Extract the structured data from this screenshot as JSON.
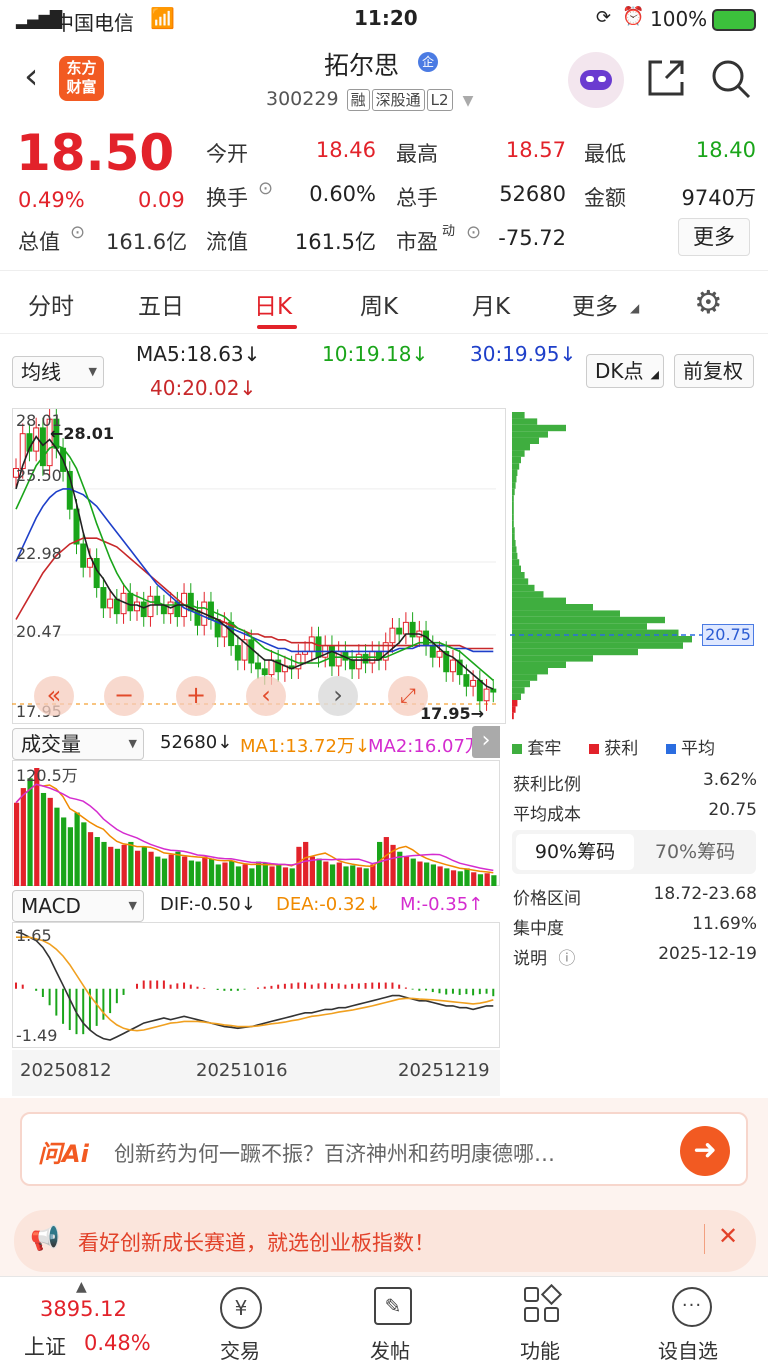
{
  "status_bar": {
    "carrier": "中国电信",
    "time": "11:20",
    "battery": "100%"
  },
  "header": {
    "logo_line1": "东方",
    "logo_line2": "财富",
    "stock_name": "拓尔思",
    "badge": "企",
    "code": "300229",
    "tags": [
      "融",
      "深股通",
      "L2"
    ]
  },
  "quote": {
    "price": "18.50",
    "change_pct": "0.49%",
    "change": "0.09",
    "open_label": "今开",
    "open": "18.46",
    "high_label": "最高",
    "high": "18.57",
    "low_label": "最低",
    "low": "18.40",
    "turnover_label": "换手",
    "turnover": "0.60%",
    "volume_label": "总手",
    "volume": "52680",
    "amount_label": "金额",
    "amount": "9740万",
    "mcap_label": "总值",
    "mcap": "161.6亿",
    "float_label": "流值",
    "float": "161.5亿",
    "pe_label": "市盈",
    "pe_sup": "动",
    "pe": "-75.72",
    "more": "更多"
  },
  "tabs": [
    "分时",
    "五日",
    "日K",
    "周K",
    "月K",
    "更多"
  ],
  "active_tab": "日K",
  "ma_bar": {
    "select": "均线",
    "ma5": "MA5:18.63↓",
    "ma10": "10:19.18↓",
    "ma30": "30:19.95↓",
    "ma40": "40:20.02↓",
    "dk": "DK点",
    "adj": "前复权"
  },
  "kline": {
    "y_labels": [
      "28.01",
      "25.50",
      "22.98",
      "20.47",
      "17.95"
    ],
    "max_mark": "28.01",
    "min_mark": "17.95"
  },
  "volume_bar": {
    "select": "成交量",
    "vol": "52680↓",
    "ma1": "MA1:13.72万↓",
    "ma2": "MA2:16.07万↓",
    "top_label": "120.5万"
  },
  "macd_bar": {
    "select": "MACD",
    "dif": "DIF:-0.50↓",
    "dea": "DEA:-0.32↓",
    "m": "M:-0.35↑",
    "top_label": "1.65",
    "bottom_label": "-1.49"
  },
  "dates": [
    "20250812",
    "20251016",
    "20251219"
  ],
  "chips": {
    "price_tag": "20.75",
    "legend": [
      "套牢",
      "获利",
      "平均"
    ],
    "profit_ratio_label": "获利比例",
    "profit_ratio": "3.62%",
    "avg_cost_label": "平均成本",
    "avg_cost": "20.75",
    "tab90": "90%筹码",
    "tab70": "70%筹码",
    "range_label": "价格区间",
    "range": "18.72-23.68",
    "conc_label": "集中度",
    "conc": "11.69%",
    "note_label": "说明",
    "note_date": "2025-12-19"
  },
  "ask": {
    "logo": "问Ai",
    "text": "创新药为何一蹶不振？百济神州和药明康德哪…"
  },
  "banner": {
    "text": "看好创新成长赛道，就选创业板指数！"
  },
  "tabbar": {
    "index_value": "3895.12",
    "index_name": "上证",
    "index_pct": "0.48%",
    "items": [
      "交易",
      "发帖",
      "功能",
      "设自选"
    ]
  },
  "colors": {
    "up": "#e2222a",
    "down": "#1aa51a",
    "accent": "#f25a22",
    "ma30": "#1e3fc9",
    "ma40": "#c8282a"
  },
  "chart_data": {
    "type": "candlestick",
    "close_series": [
      26.2,
      27.4,
      26.8,
      27.6,
      26.3,
      27.9,
      26.9,
      26.1,
      24.8,
      23.6,
      22.8,
      23.1,
      22.1,
      21.4,
      21.7,
      21.2,
      21.9,
      21.3,
      21.6,
      21.1,
      21.8,
      21.5,
      21.2,
      21.6,
      21.1,
      21.9,
      21.3,
      20.8,
      21.6,
      21.0,
      20.4,
      20.9,
      20.1,
      19.6,
      20.3,
      19.5,
      19.3,
      19.1,
      19.6,
      19.2,
      19.4,
      19.3,
      19.8,
      19.9,
      20.4,
      19.7,
      20.1,
      19.4,
      19.9,
      19.6,
      19.3,
      19.8,
      19.5,
      19.9,
      19.6,
      20.2,
      20.7,
      20.5,
      20.9,
      20.4,
      20.6,
      20.1,
      19.7,
      19.9,
      19.2,
      19.6,
      19.1,
      18.7,
      18.9,
      18.2,
      18.6,
      18.5
    ],
    "ma5_series": [
      25.5,
      26.3,
      26.9,
      27.3,
      27.0,
      27.2,
      26.9,
      26.5,
      25.9,
      25.0,
      24.0,
      23.2,
      22.7,
      22.4,
      22.0,
      21.7,
      21.6,
      21.5,
      21.5,
      21.4,
      21.5,
      21.5,
      21.5,
      21.4,
      21.5,
      21.5,
      21.4,
      21.3,
      21.2,
      21.1,
      21.0,
      20.8,
      20.6,
      20.4,
      20.2,
      20.0,
      19.8,
      19.6,
      19.6,
      19.5,
      19.4,
      19.3,
      19.4,
      19.5,
      19.6,
      19.7,
      19.8,
      19.9,
      19.8,
      19.7,
      19.6,
      19.6,
      19.6,
      19.6,
      19.6,
      19.8,
      20.0,
      20.2,
      20.5,
      20.5,
      20.5,
      20.4,
      20.2,
      20.0,
      19.8,
      19.7,
      19.5,
      19.3,
      19.1,
      18.9,
      18.7,
      18.6
    ],
    "ma10_series": [
      24.8,
      25.3,
      25.8,
      26.3,
      26.6,
      26.9,
      27.0,
      26.9,
      26.6,
      26.2,
      25.6,
      25.0,
      24.3,
      23.7,
      23.1,
      22.6,
      22.2,
      21.9,
      21.8,
      21.7,
      21.6,
      21.6,
      21.5,
      21.5,
      21.5,
      21.5,
      21.5,
      21.4,
      21.4,
      21.3,
      21.2,
      21.1,
      20.9,
      20.7,
      20.6,
      20.4,
      20.2,
      20.0,
      19.9,
      19.8,
      19.7,
      19.6,
      19.5,
      19.5,
      19.5,
      19.5,
      19.6,
      19.7,
      19.7,
      19.7,
      19.7,
      19.7,
      19.7,
      19.7,
      19.7,
      19.7,
      19.8,
      19.9,
      20.0,
      20.1,
      20.2,
      20.2,
      20.2,
      20.2,
      20.1,
      20.0,
      19.9,
      19.7,
      19.5,
      19.3,
      19.1,
      18.9
    ],
    "ma30_series": [
      23.0,
      23.5,
      24.0,
      24.5,
      24.9,
      25.2,
      25.4,
      25.5,
      25.5,
      25.4,
      25.3,
      25.1,
      24.9,
      24.6,
      24.3,
      24.0,
      23.7,
      23.4,
      23.1,
      22.8,
      22.5,
      22.2,
      22.0,
      21.8,
      21.6,
      21.4,
      21.3,
      21.2,
      21.1,
      21.0,
      20.9,
      20.8,
      20.7,
      20.6,
      20.5,
      20.4,
      20.3,
      20.2,
      20.1,
      20.0,
      20.0,
      19.9,
      19.9,
      19.9,
      19.9,
      19.9,
      19.9,
      19.9,
      19.9,
      19.9,
      19.9,
      19.9,
      19.9,
      19.9,
      19.9,
      19.9,
      19.9,
      20.0,
      20.0,
      20.0,
      20.1,
      20.1,
      20.1,
      20.1,
      20.1,
      20.0,
      20.0,
      20.0,
      19.9,
      19.9,
      19.9,
      19.9
    ],
    "ma40_series": [
      21.0,
      21.4,
      21.8,
      22.2,
      22.6,
      22.9,
      23.2,
      23.4,
      23.6,
      23.7,
      23.8,
      23.8,
      23.8,
      23.7,
      23.6,
      23.5,
      23.3,
      23.1,
      22.9,
      22.7,
      22.5,
      22.3,
      22.1,
      21.9,
      21.7,
      21.5,
      21.4,
      21.3,
      21.2,
      21.1,
      21.0,
      20.9,
      20.8,
      20.7,
      20.6,
      20.5,
      20.5,
      20.4,
      20.4,
      20.3,
      20.3,
      20.2,
      20.2,
      20.2,
      20.2,
      20.1,
      20.1,
      20.1,
      20.1,
      20.1,
      20.1,
      20.1,
      20.1,
      20.1,
      20.1,
      20.1,
      20.1,
      20.1,
      20.1,
      20.1,
      20.1,
      20.1,
      20.1,
      20.1,
      20.1,
      20.1,
      20.1,
      20.0,
      20.0,
      20.0,
      20.0,
      20.0
    ],
    "volume_series": [
      85,
      100,
      110,
      120.5,
      95,
      90,
      80,
      70,
      60,
      75,
      65,
      55,
      50,
      45,
      40,
      38,
      42,
      45,
      36,
      40,
      35,
      30,
      28,
      32,
      35,
      30,
      26,
      25,
      30,
      28,
      22,
      24,
      26,
      20,
      22,
      18,
      25,
      24,
      20,
      22,
      19,
      18,
      40,
      45,
      30,
      28,
      25,
      22,
      24,
      20,
      21,
      19,
      18,
      22,
      45,
      50,
      42,
      35,
      30,
      28,
      25,
      24,
      22,
      20,
      18,
      16,
      15,
      18,
      14,
      12,
      13,
      11
    ],
    "dif_series": [
      1.65,
      1.6,
      1.5,
      1.4,
      1.2,
      0.9,
      0.5,
      0.1,
      -0.3,
      -0.7,
      -1.0,
      -1.2,
      -1.35,
      -1.45,
      -1.49,
      -1.4,
      -1.3,
      -1.2,
      -1.1,
      -1.0,
      -0.95,
      -0.9,
      -0.85,
      -0.9,
      -0.85,
      -0.8,
      -0.85,
      -0.9,
      -0.95,
      -1.0,
      -1.05,
      -1.1,
      -1.12,
      -1.15,
      -1.12,
      -1.1,
      -1.05,
      -1.0,
      -0.95,
      -0.9,
      -0.85,
      -0.8,
      -0.75,
      -0.7,
      -0.7,
      -0.65,
      -0.6,
      -0.6,
      -0.55,
      -0.55,
      -0.5,
      -0.45,
      -0.4,
      -0.35,
      -0.3,
      -0.25,
      -0.2,
      -0.2,
      -0.25,
      -0.3,
      -0.35,
      -0.35,
      -0.4,
      -0.45,
      -0.5,
      -0.5,
      -0.55,
      -0.55,
      -0.6,
      -0.55,
      -0.5,
      -0.5
    ],
    "dea_series": [
      1.5,
      1.5,
      1.5,
      1.45,
      1.4,
      1.3,
      1.15,
      0.95,
      0.7,
      0.4,
      0.1,
      -0.2,
      -0.45,
      -0.7,
      -0.9,
      -1.05,
      -1.15,
      -1.2,
      -1.22,
      -1.2,
      -1.15,
      -1.1,
      -1.05,
      -1.0,
      -0.98,
      -0.95,
      -0.95,
      -0.95,
      -0.97,
      -1.0,
      -1.02,
      -1.05,
      -1.07,
      -1.1,
      -1.1,
      -1.1,
      -1.08,
      -1.05,
      -1.02,
      -1.0,
      -0.97,
      -0.93,
      -0.9,
      -0.85,
      -0.8,
      -0.78,
      -0.75,
      -0.72,
      -0.68,
      -0.65,
      -0.62,
      -0.58,
      -0.54,
      -0.5,
      -0.45,
      -0.4,
      -0.35,
      -0.3,
      -0.28,
      -0.28,
      -0.3,
      -0.31,
      -0.32,
      -0.34,
      -0.36,
      -0.38,
      -0.4,
      -0.42,
      -0.44,
      -0.42,
      -0.38,
      -0.32
    ]
  }
}
